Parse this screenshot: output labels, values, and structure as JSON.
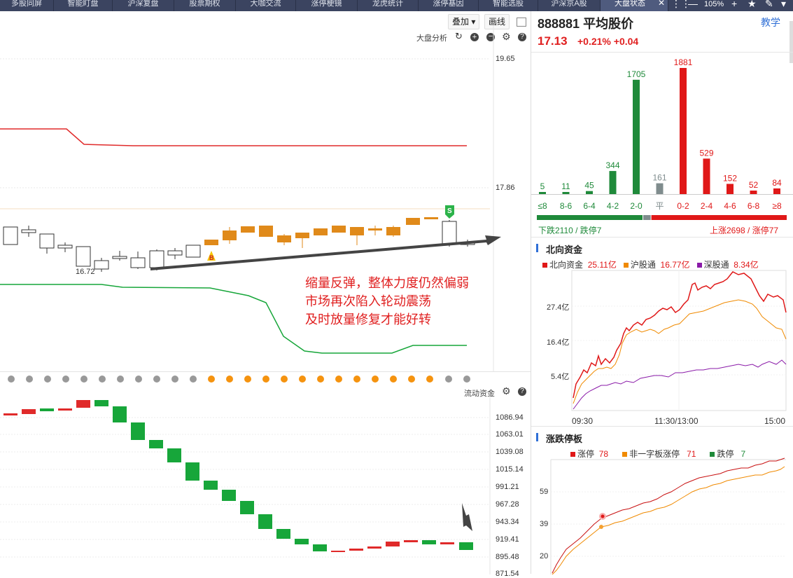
{
  "tabs": [
    "多股同屏",
    "智能盯盘",
    "沪深复盘",
    "股票期权",
    "大咖交流",
    "涨停梗镜",
    "龙虎统计",
    "涨停基因",
    "智能选股",
    "沪深京A股",
    "大盘状态"
  ],
  "tab_zoom": "105%",
  "toolbar": {
    "overlay_label": "叠加 ▾",
    "draw_label": "画线"
  },
  "main_chart": {
    "indicator_label": "大盘分析",
    "price_axis": [
      "19.65",
      "17.86"
    ],
    "low_label": "16.72",
    "buy_marker": "B",
    "sell_marker": "S",
    "annotation": [
      "缩量反弹，整体力度仍然偏弱",
      "市场再次陷入轮动震荡",
      "及时放量修复才能好转"
    ]
  },
  "flow_chart": {
    "indicator_label": "流动资金",
    "axis": [
      "1086.94",
      "1063.01",
      "1039.08",
      "1015.14",
      "991.21",
      "967.28",
      "943.34",
      "919.41",
      "895.48",
      "871.54"
    ]
  },
  "stock": {
    "code_name": "888881 平均股价",
    "price": "17.13",
    "change": "+0.21% +0.04",
    "teach": "教学"
  },
  "distribution": {
    "categories": [
      "≤8",
      "8-6",
      "6-4",
      "4-2",
      "2-0",
      "平",
      "0-2",
      "2-4",
      "4-6",
      "6-8",
      "≥8"
    ],
    "values": [
      5,
      11,
      45,
      344,
      1705,
      161,
      1881,
      529,
      152,
      52,
      84
    ],
    "colors": [
      "#1f8a3a",
      "#1f8a3a",
      "#1f8a3a",
      "#1f8a3a",
      "#1f8a3a",
      "#7f8c8d",
      "#e01818",
      "#e01818",
      "#e01818",
      "#e01818",
      "#e01818"
    ],
    "down_label": "下跌2110 / 跌停7",
    "up_label": "上涨2698 / 涨停77"
  },
  "north": {
    "title": "北向资金",
    "legend": [
      {
        "name": "北向资金",
        "value": "25.11亿",
        "color": "#e01818"
      },
      {
        "name": "沪股通",
        "value": "16.77亿",
        "color": "#f08a00"
      },
      {
        "name": "深股通",
        "value": "8.34亿",
        "color": "#8a1aa8"
      }
    ],
    "y_ticks": [
      "27.4亿",
      "16.4亿",
      "5.4亿"
    ],
    "x_ticks": [
      "09:30",
      "11:30/13:00",
      "15:00"
    ]
  },
  "limit": {
    "title": "涨跌停板",
    "legend": [
      {
        "name": "涨停",
        "value": "78",
        "color": "#e01818"
      },
      {
        "name": "非一字板涨停",
        "value": "71",
        "color": "#f08a00"
      },
      {
        "name": "跌停",
        "value": "7",
        "color": "#1f8a3a"
      }
    ],
    "y_ticks": [
      "59",
      "39",
      "20"
    ]
  },
  "colors": {
    "up": "#e01818",
    "down": "#1f8a3a",
    "candle": "#e08a1a",
    "accent": "#2f6fd6"
  }
}
